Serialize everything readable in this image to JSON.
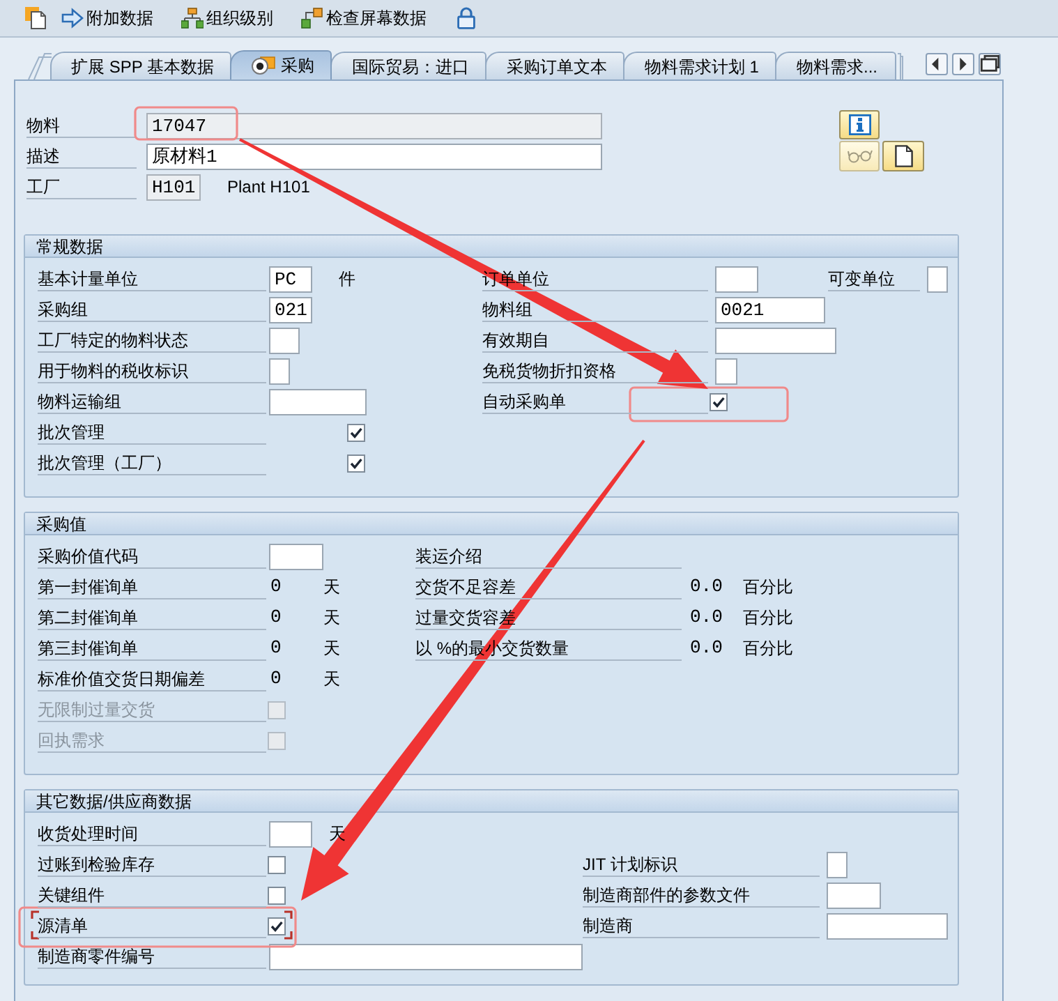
{
  "toolbar": {
    "buttons": [
      {
        "label": "附加数据"
      },
      {
        "label": "组织级别"
      },
      {
        "label": "检查屏幕数据"
      }
    ]
  },
  "tabs": [
    {
      "label": "扩展 SPP 基本数据",
      "selected": false
    },
    {
      "label": "采购",
      "selected": true
    },
    {
      "label": "国际贸易：进口",
      "selected": false
    },
    {
      "label": "采购订单文本",
      "selected": false
    },
    {
      "label": "物料需求计划 1",
      "selected": false
    },
    {
      "label": "物料需求...",
      "selected": false
    }
  ],
  "header": {
    "fields": [
      {
        "label": "物料",
        "value": "17047",
        "editable": false
      },
      {
        "label": "描述",
        "value": "原材料1",
        "editable": true
      },
      {
        "label": "工厂",
        "value": "H101",
        "editable": false,
        "description": "Plant H101"
      }
    ]
  },
  "sections": [
    {
      "title": "常规数据",
      "rows": [
        {
          "fields": [
            {
              "kind": "input",
              "label": "基本计量单位",
              "value": "PC",
              "unit": "件"
            },
            {
              "kind": "input",
              "label": "订单单位"
            },
            {
              "kind": "input",
              "label": "可变单位"
            }
          ]
        },
        {
          "fields": [
            {
              "kind": "input",
              "label": "采购组",
              "value": "021"
            },
            {
              "kind": "input",
              "label": "物料组",
              "value": "0021"
            }
          ]
        },
        {
          "fields": [
            {
              "kind": "input",
              "label": "工厂特定的物料状态"
            },
            {
              "kind": "input",
              "label": "有效期自"
            }
          ]
        },
        {
          "fields": [
            {
              "kind": "input",
              "label": "用于物料的税收标识"
            },
            {
              "kind": "input",
              "label": "免税货物折扣资格"
            }
          ]
        },
        {
          "fields": [
            {
              "kind": "input",
              "label": "物料运输组"
            },
            {
              "kind": "checkbox",
              "label": "自动采购单",
              "checked": true,
              "disabled": false
            }
          ]
        },
        {
          "fields": [
            {
              "kind": "checkbox",
              "label": "批次管理",
              "checked": true,
              "disabled": false
            }
          ]
        },
        {
          "fields": [
            {
              "kind": "checkbox",
              "label": "批次管理（工厂）",
              "checked": true,
              "disabled": false
            }
          ]
        }
      ]
    },
    {
      "title": "采购值",
      "rows": [
        {
          "fields": [
            {
              "kind": "input",
              "label": "采购价值代码"
            },
            {
              "kind": "text",
              "label": "装运介绍"
            }
          ]
        },
        {
          "fields": [
            {
              "kind": "output",
              "label": "第一封催询单",
              "value": "0",
              "unit": "天"
            },
            {
              "kind": "output",
              "label": "交货不足容差",
              "value": "0.0",
              "unit": "百分比"
            }
          ]
        },
        {
          "fields": [
            {
              "kind": "output",
              "label": "第二封催询单",
              "value": "0",
              "unit": "天"
            },
            {
              "kind": "output",
              "label": "过量交货容差",
              "value": "0.0",
              "unit": "百分比"
            }
          ]
        },
        {
          "fields": [
            {
              "kind": "output",
              "label": "第三封催询单",
              "value": "0",
              "unit": "天"
            },
            {
              "kind": "output",
              "label": "以 %的最小交货数量",
              "value": "0.0",
              "unit": "百分比"
            }
          ]
        },
        {
          "fields": [
            {
              "kind": "output",
              "label": "标准价值交货日期偏差",
              "value": "0",
              "unit": "天"
            }
          ]
        },
        {
          "fields": [
            {
              "kind": "checkbox",
              "label": "无限制过量交货",
              "checked": false,
              "disabled": true
            }
          ]
        },
        {
          "fields": [
            {
              "kind": "checkbox",
              "label": "回执需求",
              "checked": false,
              "disabled": true
            }
          ]
        }
      ]
    },
    {
      "title": "其它数据/供应商数据",
      "rows": [
        {
          "fields": [
            {
              "kind": "input",
              "label": "收货处理时间",
              "unit": "天"
            }
          ]
        },
        {
          "fields": [
            {
              "kind": "checkbox",
              "label": "过账到检验库存",
              "checked": false,
              "disabled": false
            },
            {
              "kind": "input",
              "label": "JIT 计划标识"
            }
          ]
        },
        {
          "fields": [
            {
              "kind": "checkbox",
              "label": "关键组件",
              "checked": false,
              "disabled": false
            },
            {
              "kind": "input",
              "label": "制造商部件的参数文件"
            }
          ]
        },
        {
          "fields": [
            {
              "kind": "checkbox",
              "label": "源清单",
              "checked": true,
              "disabled": false
            },
            {
              "kind": "input",
              "label": "制造商"
            }
          ]
        },
        {
          "fields": [
            {
              "kind": "input",
              "label": "制造商零件编号"
            }
          ]
        }
      ]
    }
  ]
}
